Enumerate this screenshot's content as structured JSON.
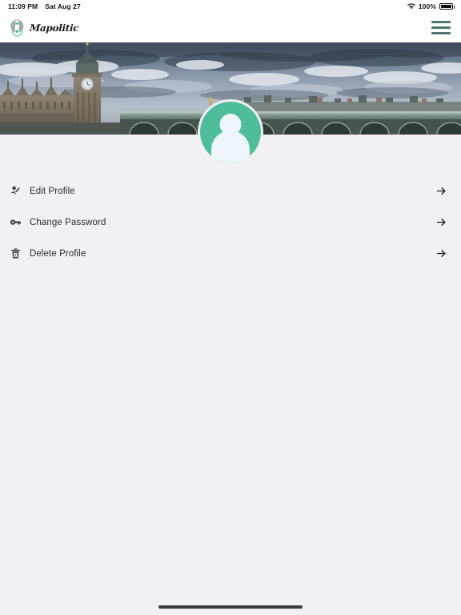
{
  "status_bar": {
    "time": "11:09 PM",
    "date": "Sat Aug 27",
    "battery_percent": "100%",
    "wifi_icon": "wifi-icon",
    "battery_icon": "battery-icon"
  },
  "app_bar": {
    "brand_name": "Mapolitic",
    "brand_mark_icon": "map-pin-logo-icon",
    "menu_icon": "hamburger-menu-icon"
  },
  "hero": {
    "image_alt": "westminster-bridge-big-ben-banner"
  },
  "profile": {
    "avatar_icon": "person-avatar-icon"
  },
  "menu": {
    "items": [
      {
        "label": "Edit Profile",
        "icon": "edit-profile-icon",
        "arrow": "arrow-right-icon"
      },
      {
        "label": "Change Password",
        "icon": "key-icon",
        "arrow": "arrow-right-icon"
      },
      {
        "label": "Delete Profile",
        "icon": "trash-icon",
        "arrow": "arrow-right-icon"
      }
    ]
  },
  "colors": {
    "accent": "#4ebd9c",
    "background": "#f0f0f5",
    "app_bar": "#ffffff",
    "menu_icon": "#4f756e",
    "text": "#2c2c30"
  },
  "home_indicator": {
    "label": "home-indicator"
  }
}
